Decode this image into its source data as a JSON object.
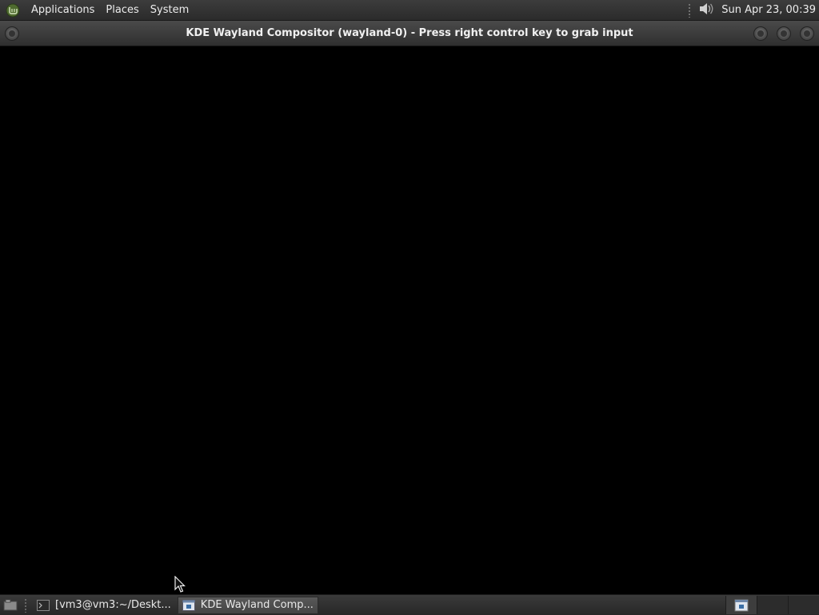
{
  "top_panel": {
    "menus": [
      "Applications",
      "Places",
      "System"
    ],
    "clock": "Sun Apr 23, 00:39",
    "icons": {
      "menu_logo": "linux-mint-logo-icon",
      "volume": "speaker-volume-icon"
    }
  },
  "window": {
    "title": "KDE Wayland Compositor (wayland-0) - Press right control key to grab input"
  },
  "taskbar": {
    "tasks": [
      {
        "label": "[vm3@vm3:~/Deskt...",
        "icon": "terminal-icon",
        "active": false
      },
      {
        "label": "KDE Wayland Comp...",
        "icon": "window-app-icon",
        "active": true
      }
    ],
    "workspaces": 4,
    "active_workspace": 1
  },
  "colors": {
    "panel": "#2e2e2e",
    "viewport": "#000000",
    "text": "#ececec"
  }
}
